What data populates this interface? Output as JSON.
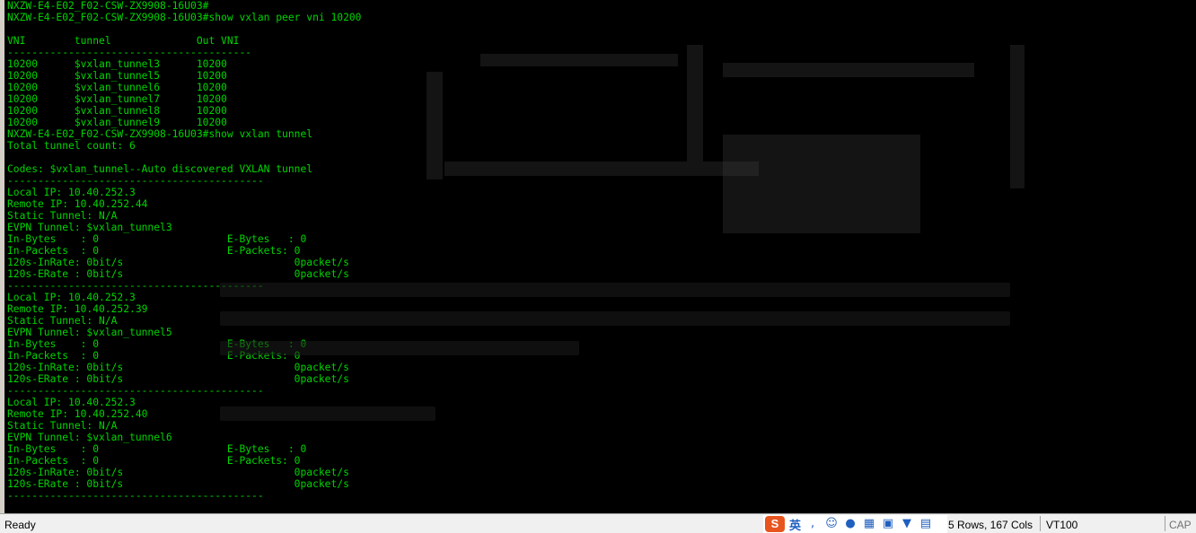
{
  "terminal": {
    "lines": [
      "NXZW-E4-E02_F02-CSW-ZX9908-16U03#",
      "NXZW-E4-E02_F02-CSW-ZX9908-16U03#show vxlan peer vni 10200",
      "",
      "VNI        tunnel              Out VNI",
      "----------------------------------------",
      "10200      $vxlan_tunnel3      10200",
      "10200      $vxlan_tunnel5      10200",
      "10200      $vxlan_tunnel6      10200",
      "10200      $vxlan_tunnel7      10200",
      "10200      $vxlan_tunnel8      10200",
      "10200      $vxlan_tunnel9      10200",
      "NXZW-E4-E02_F02-CSW-ZX9908-16U03#show vxlan tunnel",
      "Total tunnel count: 6",
      "",
      "Codes: $vxlan_tunnel--Auto discovered VXLAN tunnel",
      "------------------------------------------",
      "Local IP: 10.40.252.3",
      "Remote IP: 10.40.252.44",
      "Static Tunnel: N/A",
      "EVPN Tunnel: $vxlan_tunnel3",
      "In-Bytes    : 0                     E-Bytes   : 0",
      "In-Packets  : 0                     E-Packets: 0",
      "120s-InRate: 0bit/s                            0packet/s",
      "120s-ERate : 0bit/s                            0packet/s",
      "------------------------------------------",
      "Local IP: 10.40.252.3",
      "Remote IP: 10.40.252.39",
      "Static Tunnel: N/A",
      "EVPN Tunnel: $vxlan_tunnel5",
      "In-Bytes    : 0                     E-Bytes   : 0",
      "In-Packets  : 0                     E-Packets: 0",
      "120s-InRate: 0bit/s                            0packet/s",
      "120s-ERate : 0bit/s                            0packet/s",
      "------------------------------------------",
      "Local IP: 10.40.252.3",
      "Remote IP: 10.40.252.40",
      "Static Tunnel: N/A",
      "EVPN Tunnel: $vxlan_tunnel6",
      "In-Bytes    : 0                     E-Bytes   : 0",
      "In-Packets  : 0                     E-Packets: 0",
      "120s-InRate: 0bit/s                            0packet/s",
      "120s-ERate : 0bit/s                            0packet/s",
      "------------------------------------------"
    ],
    "text_color": "#00d400",
    "background": "#000000"
  },
  "statusbar": {
    "ready": "Ready",
    "ime_logo": "S",
    "ime_lang": "英",
    "ime_icons": [
      "punctuation-icon",
      "emoji-icon",
      "microphone-icon",
      "keyboard-icon",
      "toolbox-icon",
      "skin-icon",
      "grid-icon"
    ],
    "rows_cols": "5 Rows, 167 Cols",
    "terminal_type": "VT100",
    "caps": "CAP"
  }
}
